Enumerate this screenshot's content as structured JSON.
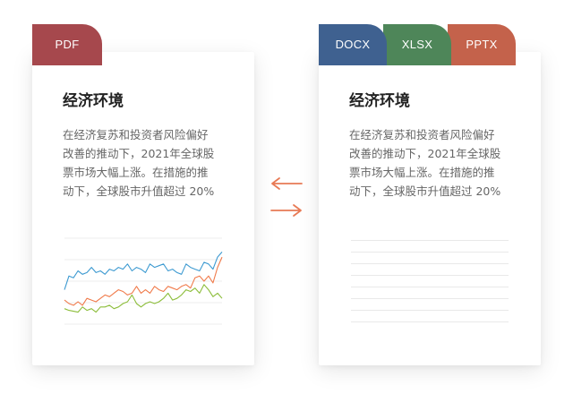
{
  "formats": {
    "source": {
      "label": "PDF",
      "color": "#a6484d"
    },
    "targets": [
      {
        "label": "DOCX",
        "color": "#3f6190"
      },
      {
        "label": "XLSX",
        "color": "#4e8659"
      },
      {
        "label": "PPTX",
        "color": "#c4624b"
      }
    ]
  },
  "document": {
    "title": "经济环境",
    "body_lines": [
      "在经济复苏和投资者风险偏好",
      "改善的推动下，2021年全球股",
      "票市场大幅上涨。在措施的推",
      "动下，全球股市升值超过 20%"
    ]
  },
  "arrow_color": "#e87a55",
  "chart_data": {
    "type": "line",
    "title": "",
    "xlabel": "",
    "ylabel": "",
    "x": [
      1,
      2,
      3,
      4,
      5,
      6,
      7,
      8,
      9,
      10,
      11,
      12,
      13,
      14,
      15,
      16,
      17,
      18,
      19,
      20,
      21,
      22,
      23,
      24,
      25,
      26,
      27,
      28,
      29,
      30,
      31,
      32,
      33,
      34,
      35,
      36
    ],
    "ylim": [
      0,
      100
    ],
    "grid": true,
    "series": [
      {
        "color": "#3d9ad1",
        "values": [
          40,
          56,
          54,
          62,
          58,
          60,
          66,
          60,
          62,
          58,
          64,
          62,
          66,
          64,
          70,
          62,
          66,
          64,
          60,
          70,
          66,
          68,
          70,
          62,
          64,
          60,
          58,
          70,
          66,
          64,
          62,
          72,
          70,
          64,
          78,
          84
        ]
      },
      {
        "color": "#f07a4a",
        "values": [
          28,
          24,
          22,
          26,
          22,
          30,
          28,
          26,
          30,
          34,
          32,
          36,
          40,
          38,
          34,
          36,
          44,
          36,
          40,
          36,
          44,
          40,
          38,
          44,
          42,
          40,
          44,
          46,
          42,
          54,
          56,
          50,
          56,
          48,
          66,
          78
        ]
      },
      {
        "color": "#8cbd3a",
        "values": [
          18,
          16,
          15,
          14,
          20,
          16,
          18,
          14,
          20,
          20,
          22,
          18,
          20,
          24,
          26,
          34,
          24,
          20,
          24,
          26,
          24,
          26,
          30,
          36,
          28,
          30,
          34,
          40,
          38,
          42,
          36,
          46,
          40,
          32,
          36,
          30
        ]
      }
    ]
  }
}
